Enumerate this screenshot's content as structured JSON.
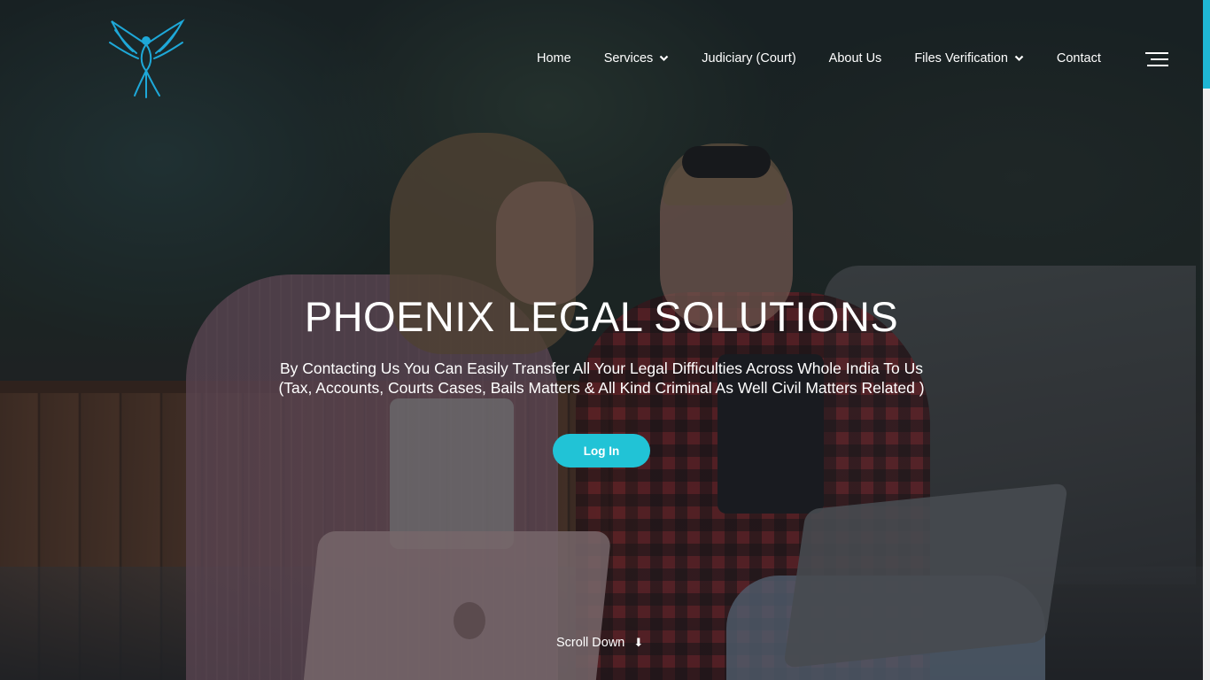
{
  "brand": {
    "logo_icon": "phoenix-bird-icon",
    "accent_color": "#1fb6d4"
  },
  "nav": {
    "items": [
      {
        "label": "Home",
        "has_dropdown": false
      },
      {
        "label": "Services",
        "has_dropdown": true
      },
      {
        "label": "Judiciary (Court)",
        "has_dropdown": false
      },
      {
        "label": "About Us",
        "has_dropdown": false
      },
      {
        "label": "Files Verification",
        "has_dropdown": true
      },
      {
        "label": "Contact",
        "has_dropdown": false
      }
    ],
    "menu_icon": "hamburger-menu-icon"
  },
  "hero": {
    "title": "PHOENIX LEGAL SOLUTIONS",
    "subtitle_line1": "By Contacting Us You Can Easily Transfer All Your Legal Difficulties Across Whole India To Us",
    "subtitle_line2": "(Tax, Accounts, Courts Cases, Bails Matters & All Kind Criminal As Well Civil Matters Related )",
    "login_label": "Log In",
    "button_color": "#21c3d6",
    "scroll_label": "Scroll Down",
    "scroll_icon": "arrow-down-icon"
  }
}
